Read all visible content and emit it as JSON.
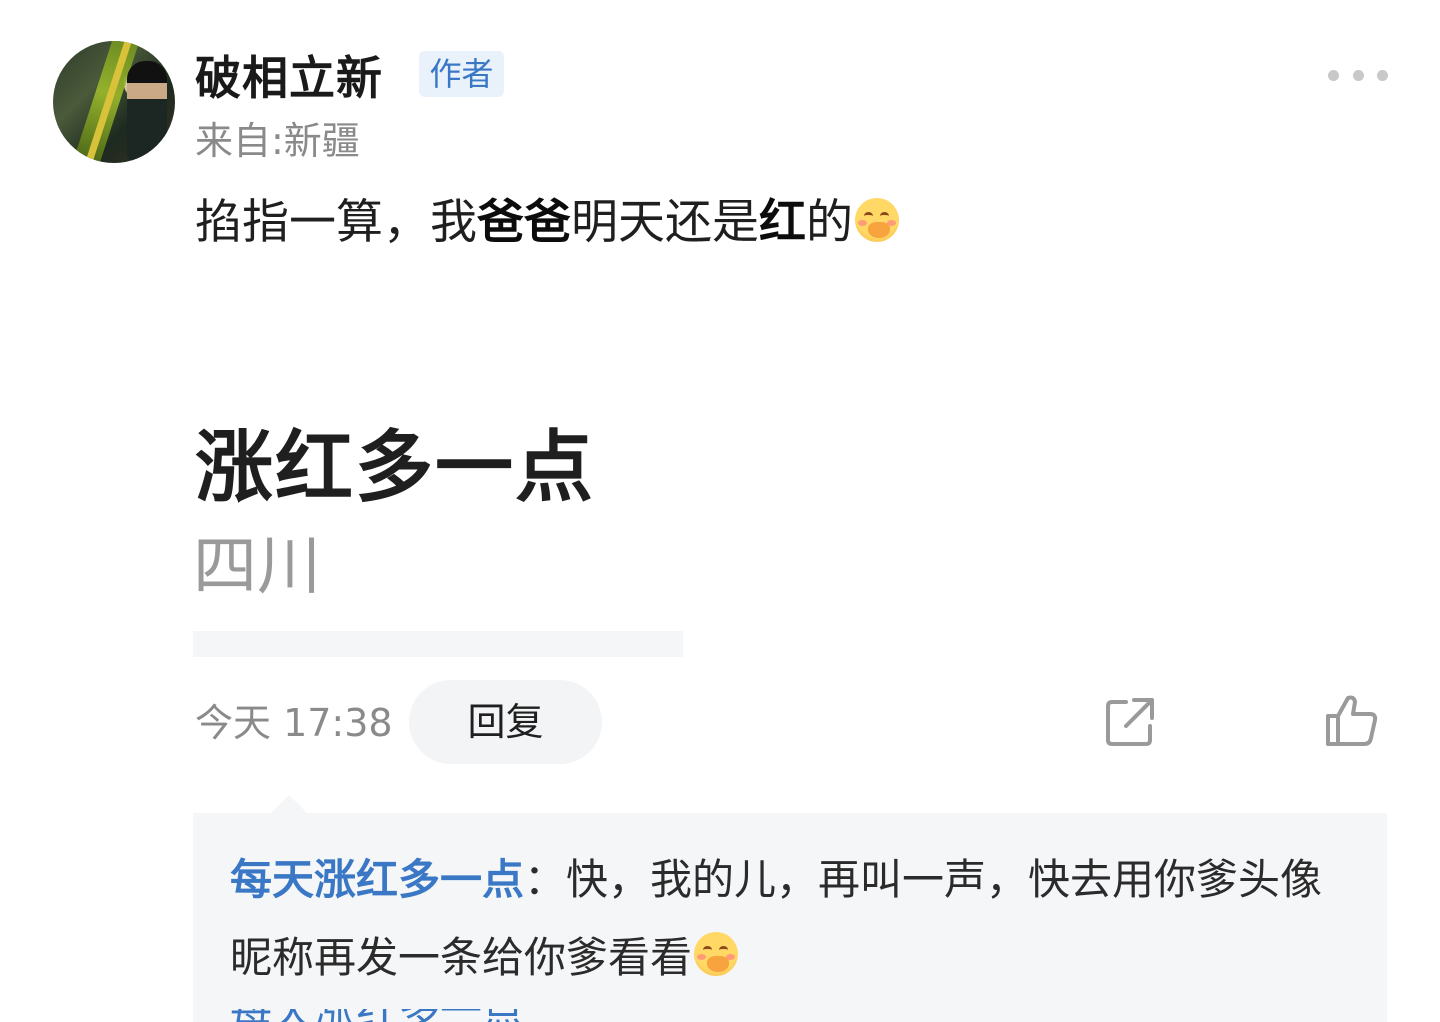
{
  "post": {
    "username": "破相立新",
    "badge": "作者",
    "location": "来自:新疆",
    "content_parts": [
      "掐指一算，我",
      "爸爸",
      "明天还是",
      "红",
      "的"
    ],
    "emoji": "blushing-face-emoji"
  },
  "embedded_card": {
    "title": "涨红多一点",
    "subtitle": "四川"
  },
  "actions": {
    "time": "今天 17:38",
    "reply_label": "回复"
  },
  "reply": {
    "user": "每天涨红多一点",
    "separator": "：",
    "text": "快，我的儿，再叫一声，快去用你爹头像昵称再发一条给你爹看看",
    "emoji": "shy-smile-emoji",
    "next_user_partial": "每天涨红多一点"
  },
  "colors": {
    "link_blue": "#3a78c6",
    "badge_bg": "#e9f1fb",
    "muted_gray": "#8a8a8a",
    "panel_bg": "#f5f6f8"
  }
}
